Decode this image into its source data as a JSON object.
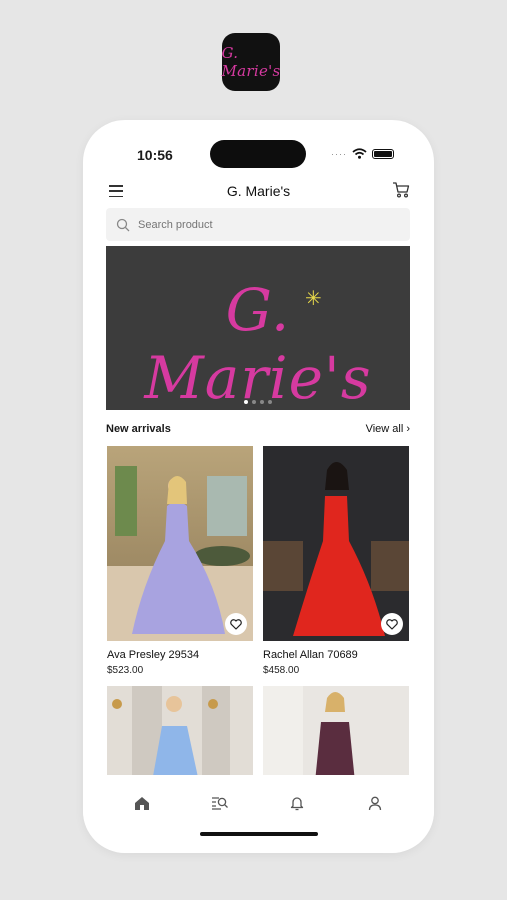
{
  "app_icon": {
    "text": "G. Marie's"
  },
  "status": {
    "time": "10:56",
    "signal_dots": "····"
  },
  "header": {
    "title": "G. Marie's"
  },
  "search": {
    "placeholder": "Search product"
  },
  "banner": {
    "logo_text": "G. Marie's",
    "logo_color": "#d63aa0",
    "slide_count": 4,
    "active_slide": 1
  },
  "section": {
    "title": "New arrivals",
    "view_all": "View all ›"
  },
  "products": [
    {
      "name": "Ava Presley 29534",
      "price": "$523.00"
    },
    {
      "name": "Rachel Allan 70689",
      "price": "$458.00"
    },
    {
      "name": "",
      "price": ""
    },
    {
      "name": "",
      "price": ""
    }
  ],
  "tabs": [
    {
      "icon": "home-icon"
    },
    {
      "icon": "browse-icon"
    },
    {
      "icon": "bell-icon"
    },
    {
      "icon": "profile-icon"
    }
  ]
}
